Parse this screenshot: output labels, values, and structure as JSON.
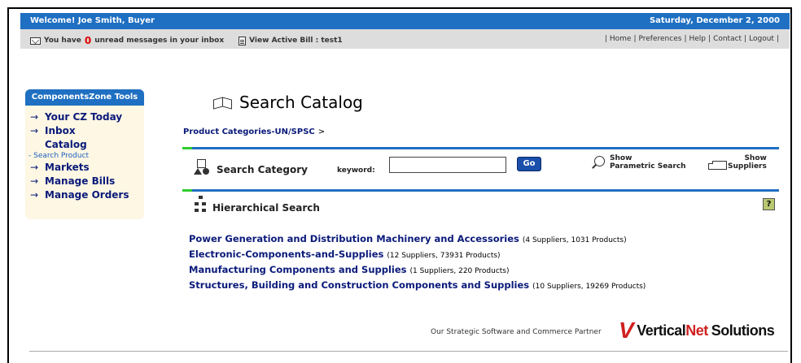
{
  "topbar": {
    "welcome": "Welcome! Joe Smith, Buyer",
    "date": "Saturday, December 2, 2000"
  },
  "subbar": {
    "msg_prefix": "You have",
    "unread_count": "0",
    "msg_suffix": "unread messages in your inbox",
    "bill": "View Active Bill : test1",
    "links": [
      "Home",
      "Preferences",
      "Help",
      "Contact",
      "Logout"
    ]
  },
  "sidebar": {
    "title": "ComponentsZone Tools",
    "items": [
      {
        "label": "Your CZ Today"
      },
      {
        "label": "Inbox"
      },
      {
        "label": "Catalog"
      },
      {
        "label": "- Search Product"
      },
      {
        "label": "Markets"
      },
      {
        "label": "Manage Bills"
      },
      {
        "label": "Manage Orders"
      }
    ]
  },
  "page": {
    "title": "Search Catalog",
    "breadcrumb": "Product Categories-UN/SPSC",
    "breadcrumb_sep": ">"
  },
  "search": {
    "category_label": "Search Category",
    "keyword_label": "keyword:",
    "keyword_value": "",
    "go_label": "Go",
    "parametric_top": "Show",
    "parametric_bottom": "Parametric Search",
    "suppliers_top": "Show",
    "suppliers_bottom": "Suppliers"
  },
  "hierarchical": {
    "label": "Hierarchical Search",
    "help": "?"
  },
  "categories": [
    {
      "name": "Power Generation and Distribution Machinery and Accessories",
      "count": "(4 Suppliers,   1031 Products)"
    },
    {
      "name": "Electronic-Components-and-Supplies",
      "count": "(12 Suppliers,   73931 Products)"
    },
    {
      "name": "Manufacturing Components and Supplies",
      "count": "(1 Suppliers,   220 Products)"
    },
    {
      "name": "Structures, Building and Construction Components and Supplies",
      "count": "(10 Suppliers,   19269 Products)"
    }
  ],
  "footer": {
    "partner": "Our Strategic Software and Commerce Partner",
    "logo_v": "V",
    "logo_vertical": "Vertical",
    "logo_net": "Net",
    "logo_solutions": "Solutions"
  },
  "colors": {
    "brand_blue": "#1f6fc2",
    "accent_green": "#2fcc2f",
    "link_navy": "#0a1a7a",
    "alert_red": "#e00000"
  }
}
